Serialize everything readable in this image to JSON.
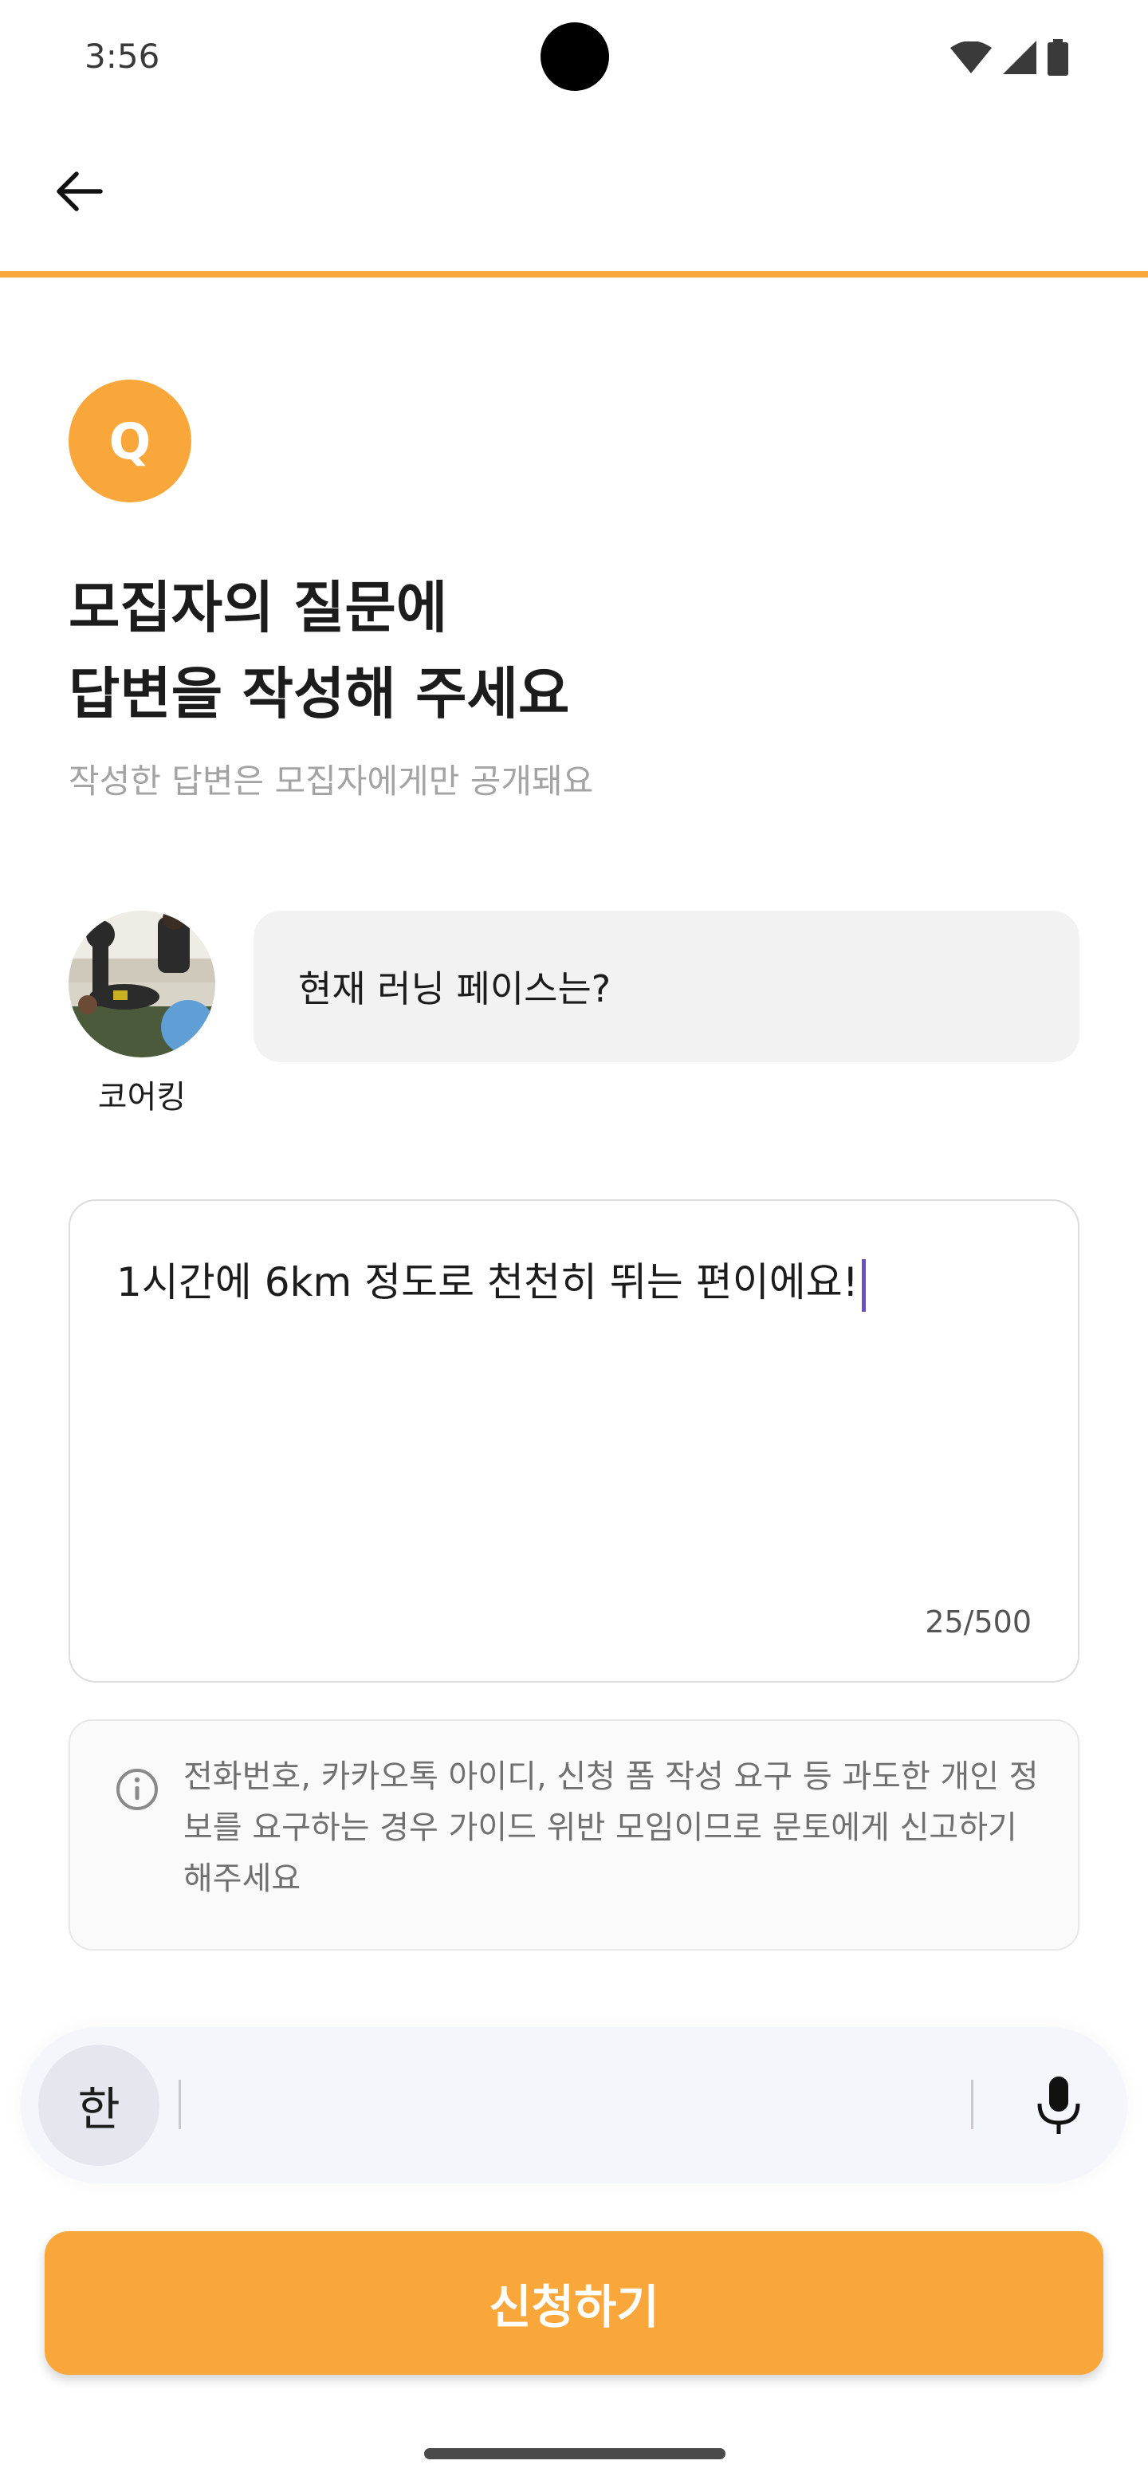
{
  "status_bar": {
    "time": "3:56"
  },
  "header": {
    "back_icon": "arrow-left-icon"
  },
  "progress": {
    "fraction": 1.0,
    "color": "#f9a73b"
  },
  "question_badge": {
    "letter": "Q"
  },
  "title": {
    "line1": "모집자의 질문에",
    "line2": "답변을 작성해 주세요"
  },
  "subtitle": "작성한 답변은 모집자에게만 공개돼요",
  "host": {
    "name": "코어킹"
  },
  "question": {
    "text": "현재 러닝 페이스는?"
  },
  "answer": {
    "value": "1시간에 6km 정도로 천천히 뛰는 편이에요!",
    "counter": "25/500"
  },
  "notice": {
    "icon": "info-icon",
    "text": "전화번호, 카카오톡 아이디, 신청 폼 작성 요구 등 과도한 개인 정보를 요구하는 경우 가이드 위반 모임이므로 문토에게 신고하기 해주세요"
  },
  "keyboard": {
    "language_key": "한",
    "mic_icon": "mic-icon"
  },
  "submit": {
    "label": "신청하기"
  },
  "colors": {
    "accent": "#f9a73b",
    "caret": "#6a4fc8"
  }
}
